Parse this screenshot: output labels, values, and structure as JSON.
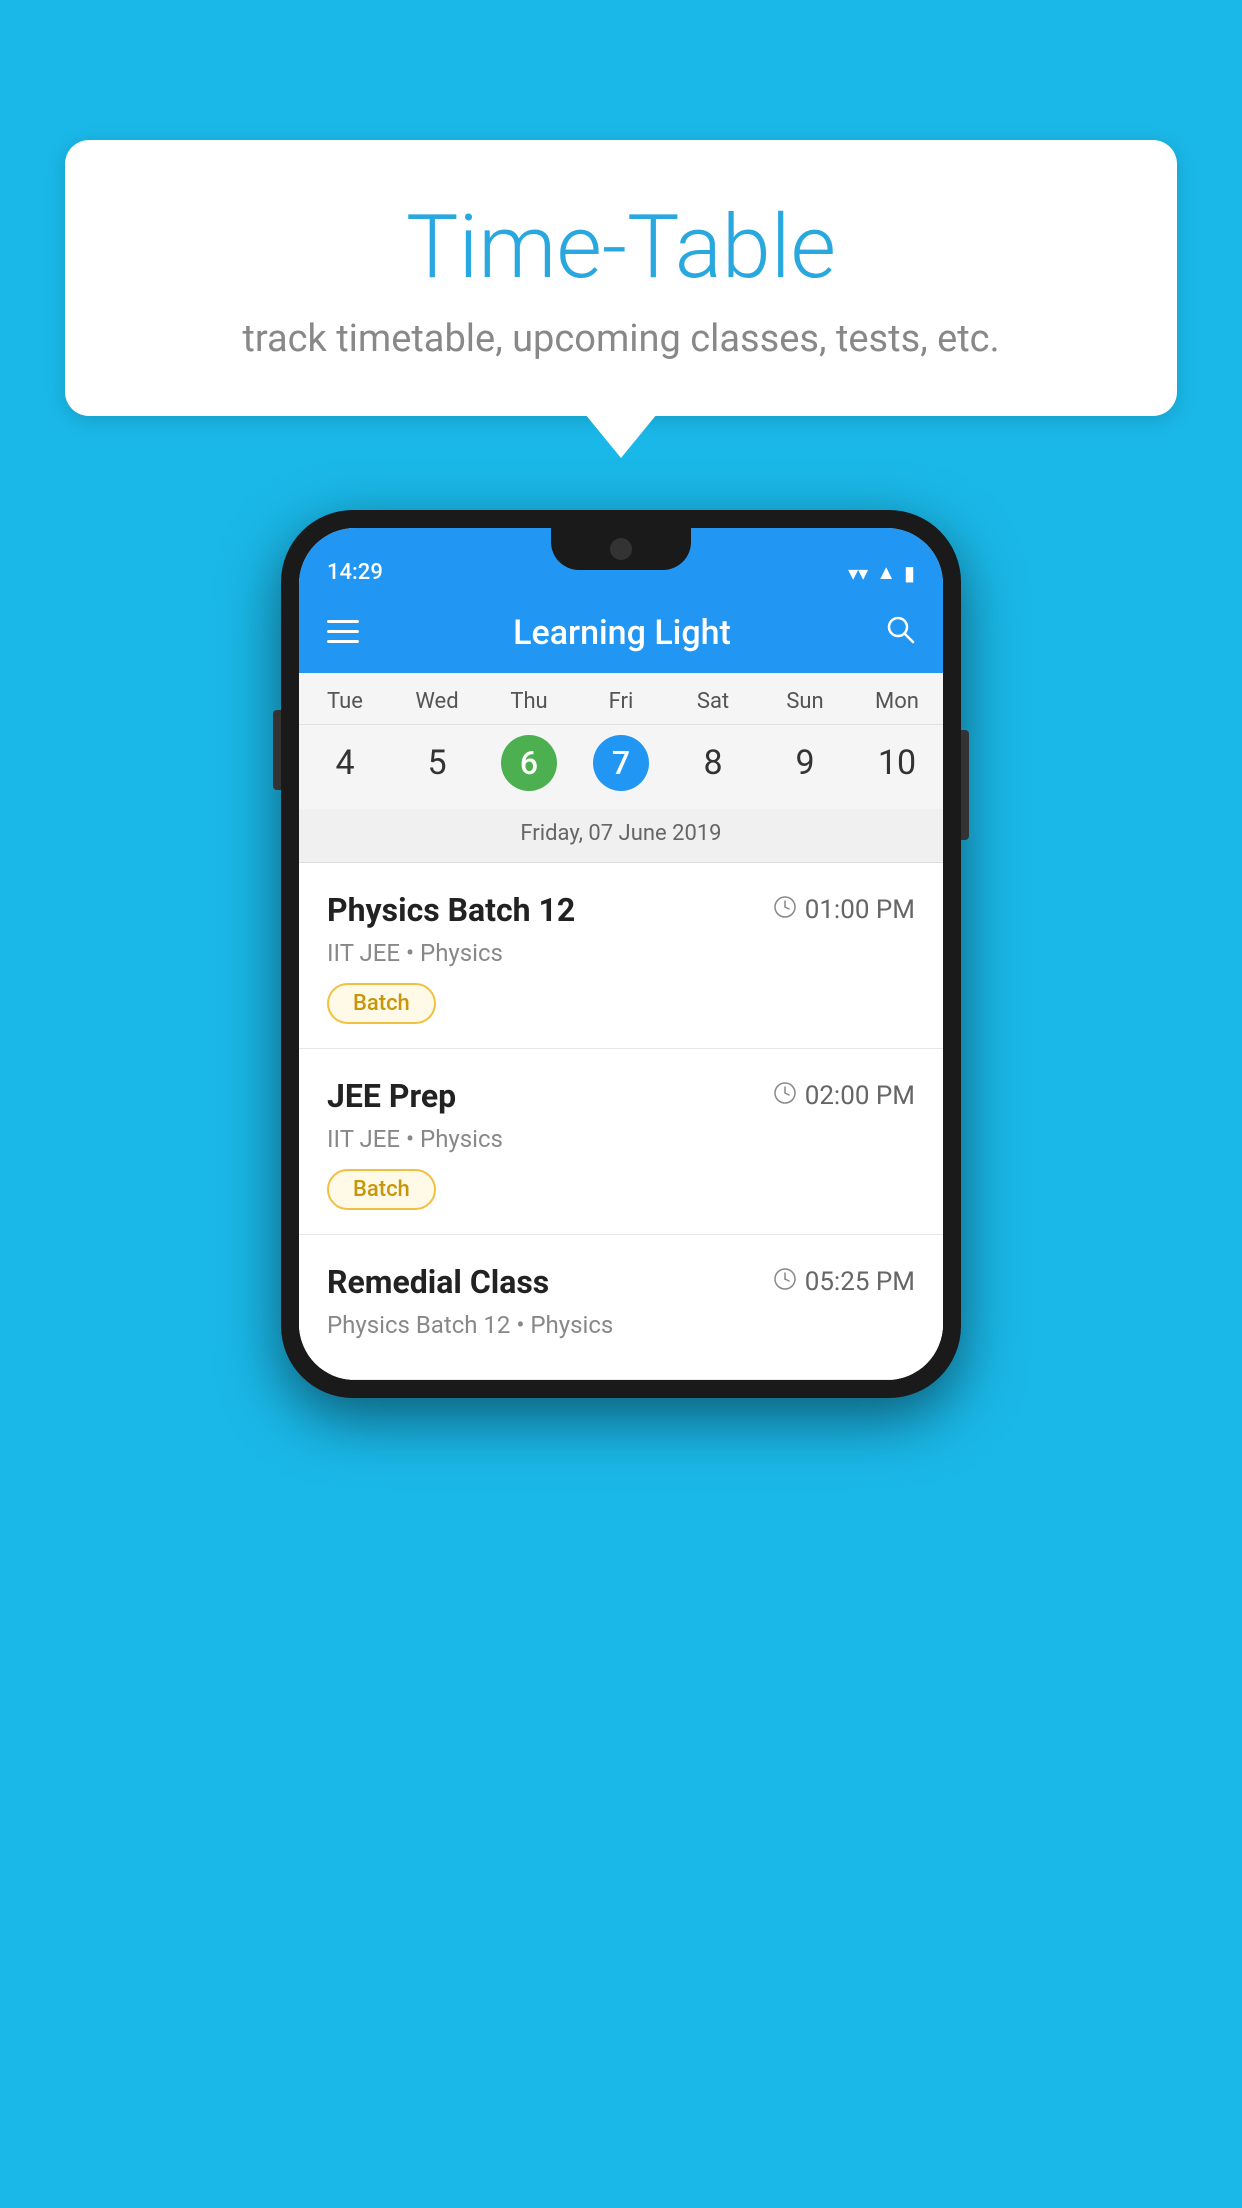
{
  "background": {
    "color": "#1ab8e8"
  },
  "speech_bubble": {
    "title": "Time-Table",
    "subtitle": "track timetable, upcoming classes, tests, etc."
  },
  "phone": {
    "status_bar": {
      "time": "14:29",
      "wifi_icon": "wifi",
      "signal_icon": "signal",
      "battery_icon": "battery"
    },
    "app_bar": {
      "title": "Learning Light",
      "menu_icon": "menu",
      "search_icon": "search"
    },
    "calendar": {
      "days": [
        {
          "name": "Tue",
          "number": "4",
          "state": "normal"
        },
        {
          "name": "Wed",
          "number": "5",
          "state": "normal"
        },
        {
          "name": "Thu",
          "number": "6",
          "state": "today"
        },
        {
          "name": "Fri",
          "number": "7",
          "state": "selected"
        },
        {
          "name": "Sat",
          "number": "8",
          "state": "normal"
        },
        {
          "name": "Sun",
          "number": "9",
          "state": "normal"
        },
        {
          "name": "Mon",
          "number": "10",
          "state": "normal"
        }
      ],
      "selected_date_label": "Friday, 07 June 2019"
    },
    "schedule": {
      "items": [
        {
          "title": "Physics Batch 12",
          "time": "01:00 PM",
          "subtitle": "IIT JEE • Physics",
          "tag": "Batch"
        },
        {
          "title": "JEE Prep",
          "time": "02:00 PM",
          "subtitle": "IIT JEE • Physics",
          "tag": "Batch"
        },
        {
          "title": "Remedial Class",
          "time": "05:25 PM",
          "subtitle": "Physics Batch 12 • Physics",
          "tag": null
        }
      ]
    }
  }
}
